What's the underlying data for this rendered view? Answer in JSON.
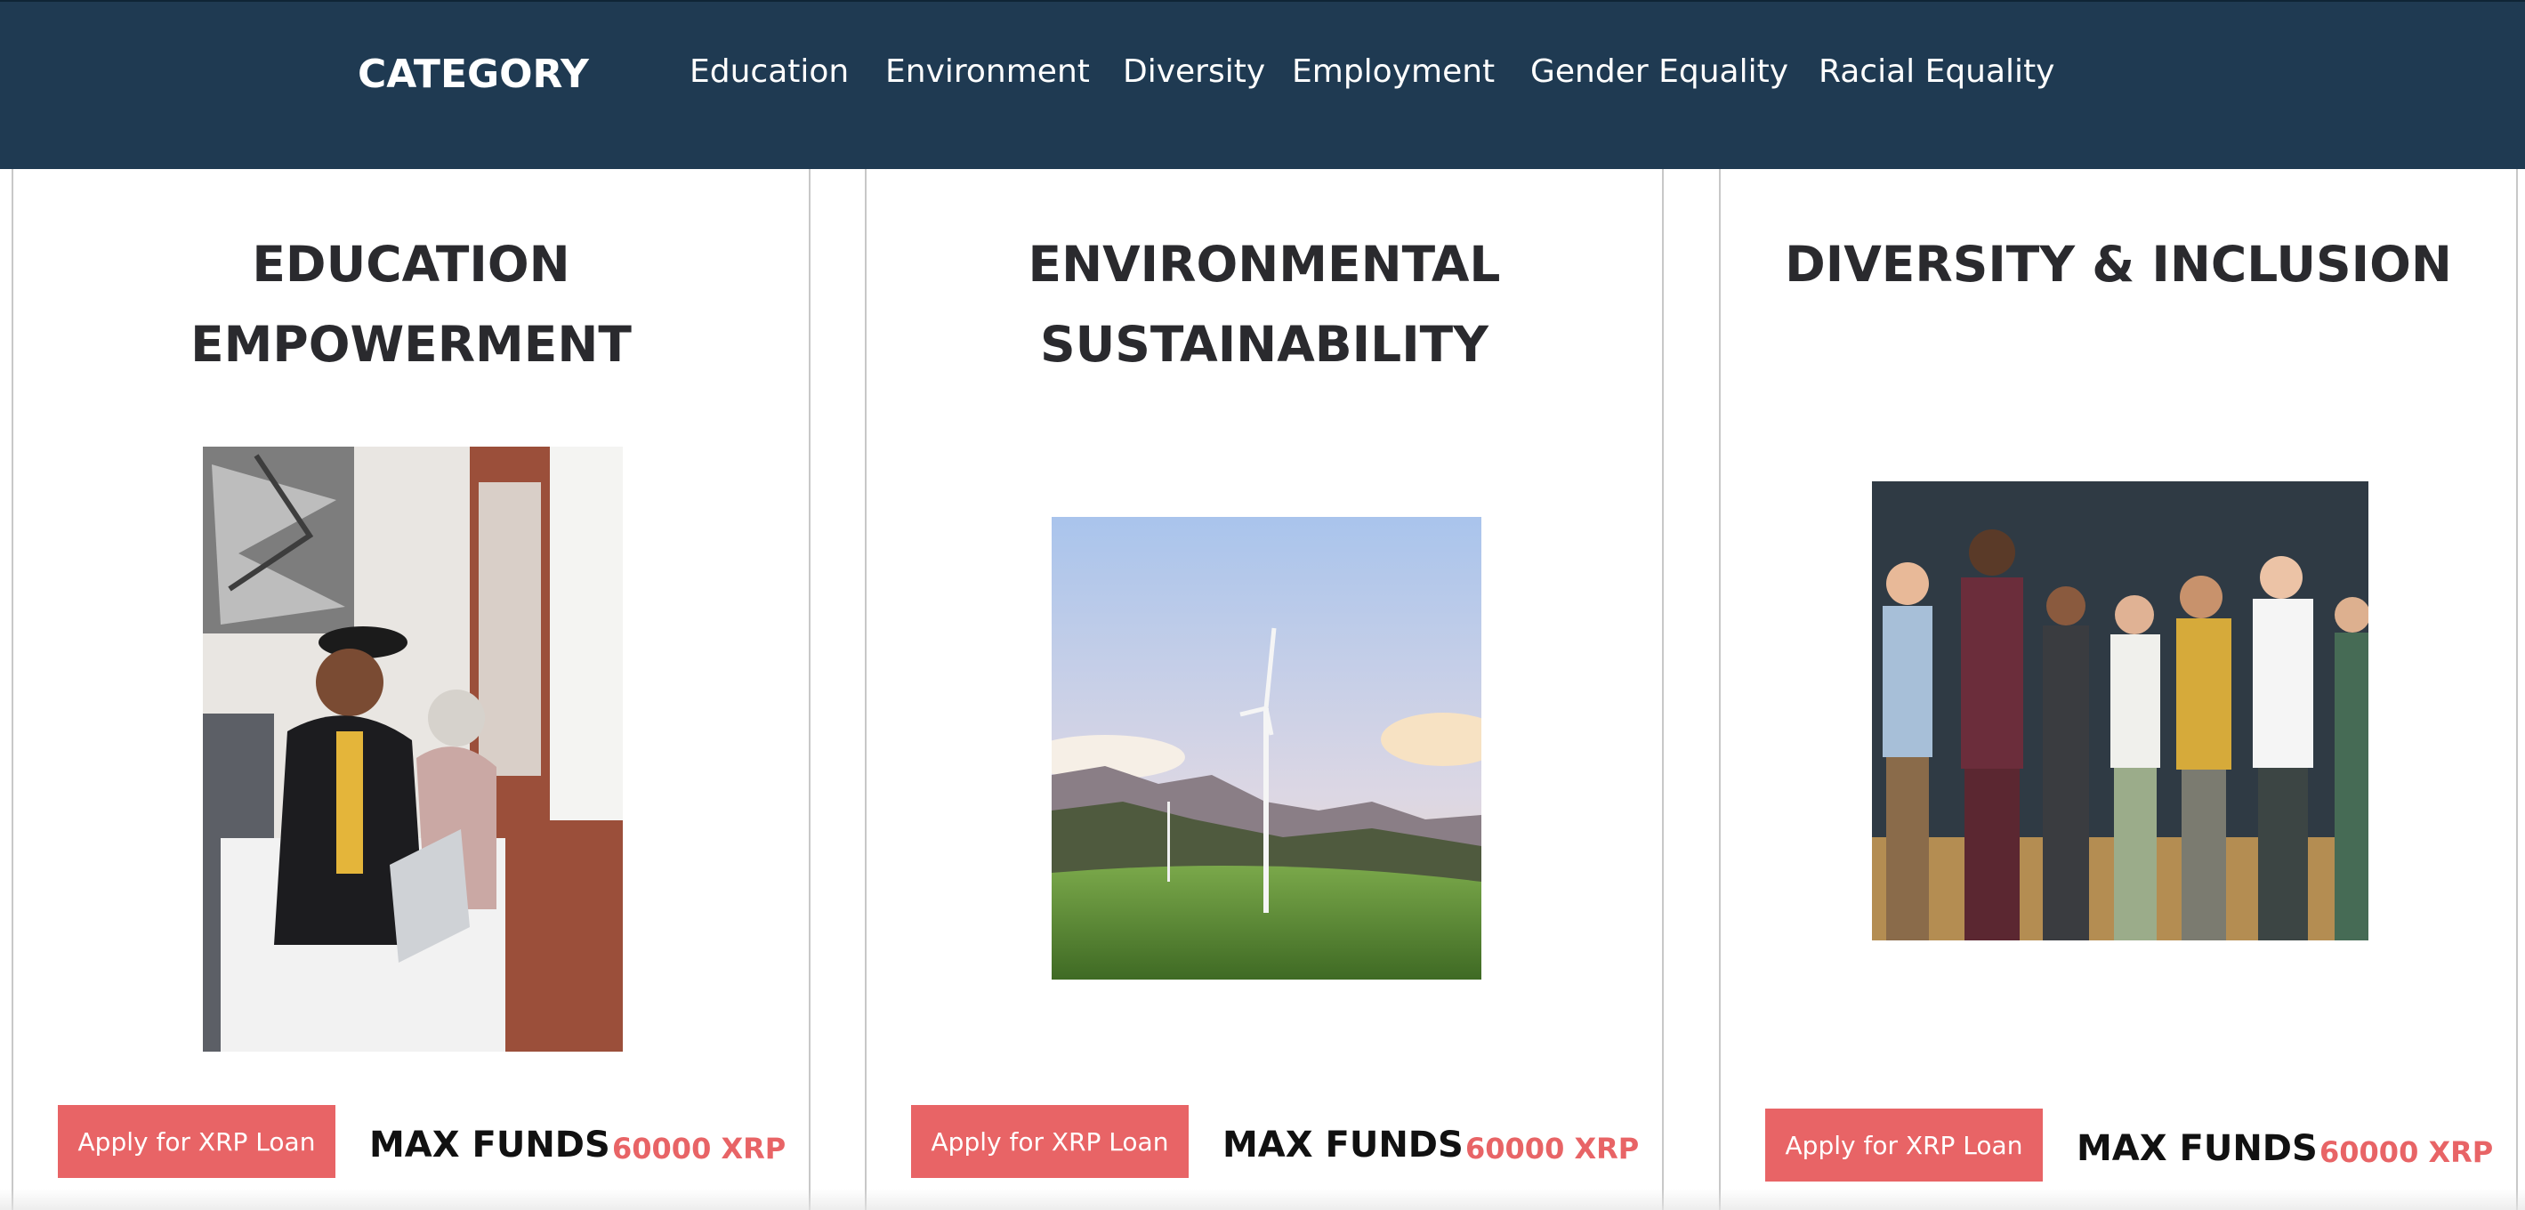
{
  "navbar": {
    "brand": "CATEGORY",
    "links": [
      "Education",
      "Environment",
      "Diversity",
      "Employment",
      "Gender Equality",
      "Racial Equality"
    ]
  },
  "cards": [
    {
      "title_line1": "EDUCATION",
      "title_line2": "EMPOWERMENT",
      "image": "graduate-video-call-photo",
      "button_label": "Apply for XRP Loan",
      "max_label": "MAX FUNDS",
      "max_value": "60000 XRP"
    },
    {
      "title_line1": "ENVIRONMENTAL",
      "title_line2": "SUSTAINABILITY",
      "image": "wind-turbine-photo",
      "button_label": "Apply for XRP Loan",
      "max_label": "MAX FUNDS",
      "max_value": "60000 XRP"
    },
    {
      "title_line1": "DIVERSITY & INCLUSION",
      "title_line2": "",
      "image": "diverse-group-photo",
      "button_label": "Apply for XRP Loan",
      "max_label": "MAX FUNDS",
      "max_value": "60000 XRP"
    }
  ],
  "colors": {
    "navbar": "#1f3a52",
    "accent": "#e86466",
    "title_text": "#2a2a2e"
  }
}
